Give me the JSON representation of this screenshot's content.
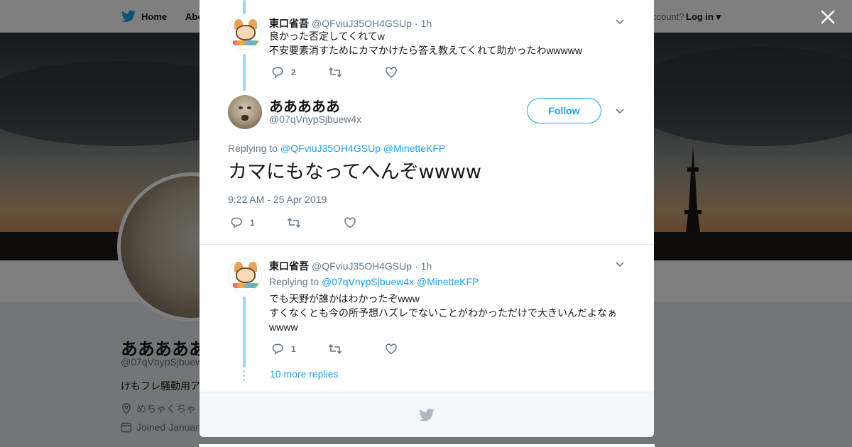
{
  "topbar": {
    "home_label": "Home",
    "about_label": "Abo",
    "account_text": "ccount?",
    "login_label": "Log in"
  },
  "profile": {
    "name": "あああああ",
    "handle": "@07qVnypSjbuew",
    "bio": "けもフレ騒動用ア",
    "location": "めちゃくちゃ",
    "joined": "Joined Januar"
  },
  "thread": {
    "prev_reply": {
      "name": "東口省吾",
      "handle": "@QFviuJ35OH4GSUp",
      "time": "· 1h",
      "lines": [
        "良かった否定してくれてw",
        "不安要素消すためにカマかけたら答え教えてくれて助かったわwwwww"
      ],
      "reply_count": "2"
    },
    "focus": {
      "name": "あああああ",
      "handle": "@07qVnypSjbuew4x",
      "follow_label": "Follow",
      "replying_prefix": "Replying to",
      "replying_to": [
        "@QFviuJ35OH4GSUp",
        "@MinetteKFP"
      ],
      "text": "カマにもなってへんぞwwww",
      "timestamp": "9:22 AM - 25 Apr 2019",
      "reply_count": "1"
    },
    "next_reply": {
      "name": "東口省吾",
      "handle": "@QFviuJ35OH4GSUp",
      "time": "· 1h",
      "replying_prefix": "Replying to",
      "replying_to": [
        "@07qVnypSjbuew4x",
        "@MinetteKFP"
      ],
      "lines": [
        "でも天野が誰かはわかったぞwww",
        "すくなくとも今の所予想ハズレでないことがわかっただけで大きいんだよなぁ",
        "wwww"
      ],
      "reply_count": "1"
    },
    "more_replies": "10 more replies"
  },
  "colors": {
    "accent": "#1da1f2",
    "thread_line": "#9fd3f2",
    "muted": "#657786"
  }
}
